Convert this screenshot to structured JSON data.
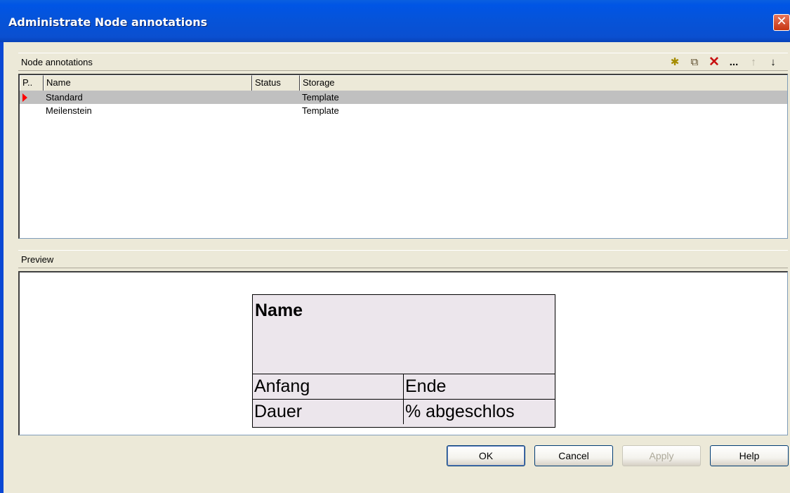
{
  "window": {
    "title": "Administrate Node annotations",
    "close_glyph": "✕"
  },
  "annotations": {
    "header_label": "Node annotations",
    "toolbar": [
      {
        "name": "new-icon",
        "glyph": "✱"
      },
      {
        "name": "copy-icon",
        "glyph": "⧉"
      },
      {
        "name": "delete-icon",
        "glyph": "✕"
      },
      {
        "name": "more-icon",
        "glyph": "..."
      },
      {
        "name": "move-up-icon",
        "glyph": "↑"
      },
      {
        "name": "move-down-icon",
        "glyph": "↓"
      }
    ],
    "columns": [
      "P..",
      "Name",
      "Status",
      "Storage"
    ],
    "rows": [
      {
        "name": "Standard",
        "status": "",
        "storage": "Template",
        "selected": true
      },
      {
        "name": "Meilenstein",
        "status": "",
        "storage": "Template",
        "selected": false
      }
    ]
  },
  "preview": {
    "header_label": "Preview",
    "node": {
      "name": "Name",
      "cells": [
        "Anfang",
        "Ende",
        "Dauer",
        "% abgeschlos"
      ]
    }
  },
  "buttons": {
    "ok": "OK",
    "cancel": "Cancel",
    "apply": "Apply",
    "help": "Help"
  },
  "colors": {
    "titlebar": "#0653d8",
    "selected_row": "#c0c0c0",
    "row_marker": "#ff0000",
    "preview_fill": "#ece6ec",
    "dialog_bg": "#ece9d8"
  }
}
